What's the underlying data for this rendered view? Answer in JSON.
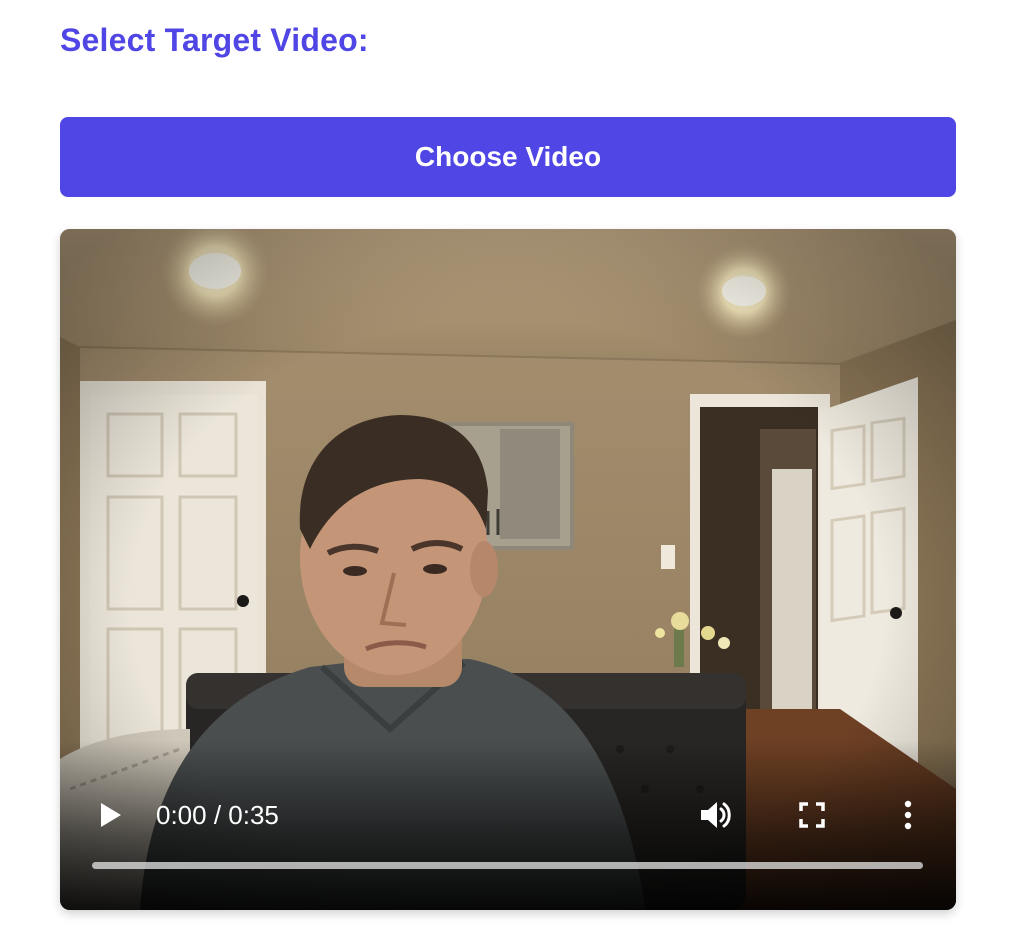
{
  "header": {
    "title": "Select Target Video:"
  },
  "upload": {
    "button_label": "Choose Video"
  },
  "video": {
    "current_time": "0:00",
    "duration": "0:35",
    "time_display": "0:00 / 0:35",
    "progress": 0,
    "controls": {
      "play_icon": "play-icon",
      "volume_icon": "volume-icon",
      "fullscreen_icon": "fullscreen-icon",
      "more_icon": "more-options-icon"
    }
  },
  "colors": {
    "accent": "#4f46e5",
    "button_text": "#ffffff"
  }
}
